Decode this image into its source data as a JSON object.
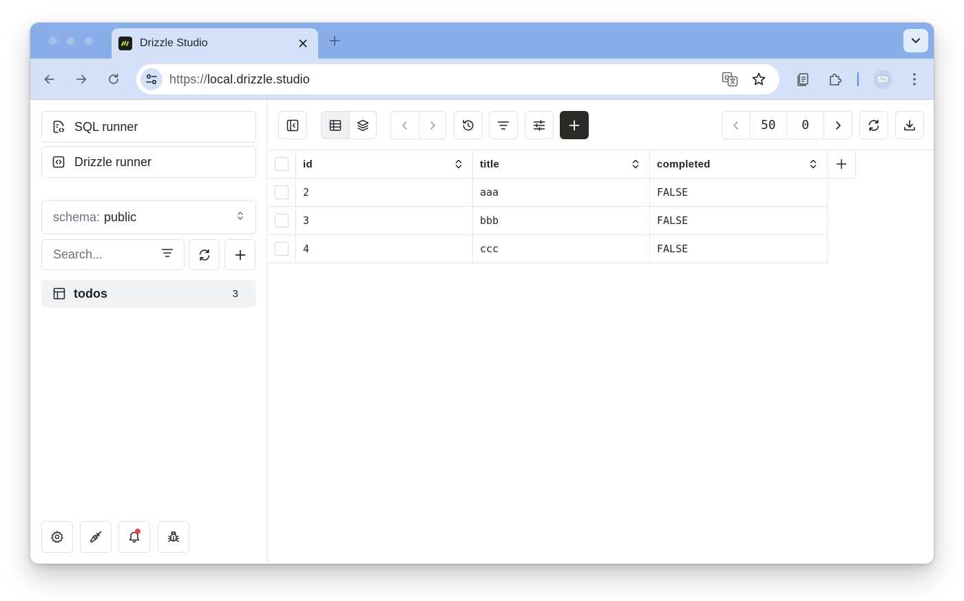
{
  "browser": {
    "tab_title": "Drizzle Studio",
    "url_scheme": "https://",
    "url_host": "local.drizzle.studio"
  },
  "sidebar": {
    "sql_runner_label": "SQL runner",
    "drizzle_runner_label": "Drizzle runner",
    "schema_label": "schema:",
    "schema_value": "public",
    "search_placeholder": "Search...",
    "tables": [
      {
        "name": "todos",
        "count": "3"
      }
    ]
  },
  "toolbar": {
    "page_size": "50",
    "offset": "0"
  },
  "grid": {
    "columns": [
      "id",
      "title",
      "completed"
    ],
    "rows": [
      [
        "2",
        "aaa",
        "FALSE"
      ],
      [
        "3",
        "bbb",
        "FALSE"
      ],
      [
        "4",
        "ccc",
        "FALSE"
      ]
    ]
  },
  "colors": {
    "tab_strip": "#8aaee9",
    "toolbar_bg": "#d4e1f8",
    "primary_button": "#2a2a27",
    "notification_dot": "#e5484d"
  }
}
